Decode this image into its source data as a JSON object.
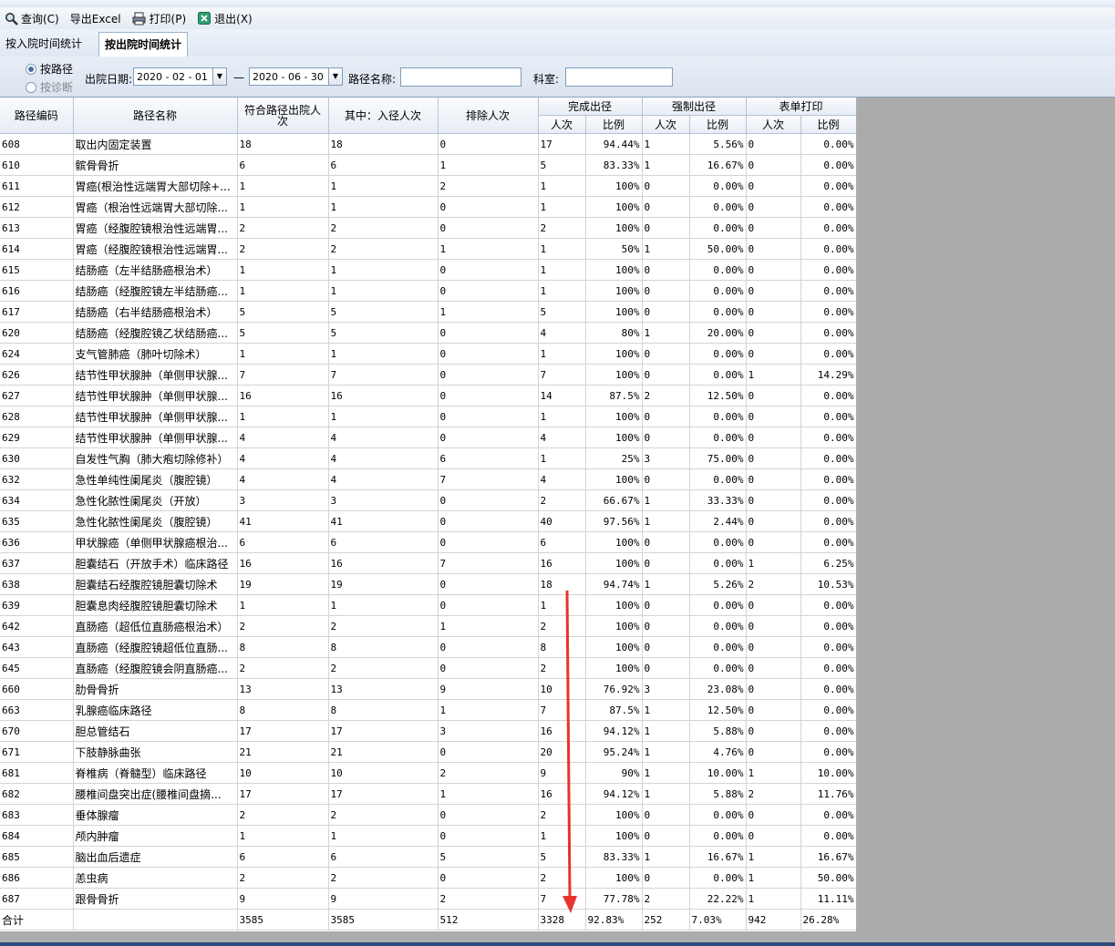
{
  "toolbar": {
    "query_label": "查询(C)",
    "export_label": "导出Excel",
    "print_label": "打印(P)",
    "exit_label": "退出(X)"
  },
  "tabs": [
    {
      "label": "按入院时间统计",
      "active": false
    },
    {
      "label": "按出院时间统计",
      "active": true
    }
  ],
  "filter": {
    "radio_path": "按路径",
    "radio_diag": "按诊断",
    "date_label": "出院日期:",
    "date_from": "2020 - 02 - 01",
    "date_sep": "—",
    "date_to": "2020 - 06 - 30",
    "path_name_label": "路径名称:",
    "path_name_value": "",
    "dept_label": "科室:",
    "dept_value": ""
  },
  "table": {
    "headers": {
      "code": "路径编码",
      "name": "路径名称",
      "eligible": "符合路径出院人次",
      "entered": "其中：入径人次",
      "excluded": "排除人次",
      "complete": "完成出径",
      "forced": "强制出径",
      "form_print": "表单打印",
      "count": "人次",
      "ratio": "比例"
    },
    "rows": [
      [
        "608",
        "取出内固定装置",
        "18",
        "18",
        "0",
        "17",
        "94.44%",
        "1",
        "5.56%",
        "0",
        "0.00%"
      ],
      [
        "610",
        "髌骨骨折",
        "6",
        "6",
        "1",
        "5",
        "83.33%",
        "1",
        "16.67%",
        "0",
        "0.00%"
      ],
      [
        "611",
        "胃癌(根治性远端胃大部切除+...",
        "1",
        "1",
        "2",
        "1",
        "100%",
        "0",
        "0.00%",
        "0",
        "0.00%"
      ],
      [
        "612",
        "胃癌（根治性远端胃大部切除...",
        "1",
        "1",
        "0",
        "1",
        "100%",
        "0",
        "0.00%",
        "0",
        "0.00%"
      ],
      [
        "613",
        "胃癌（经腹腔镜根治性远端胃...",
        "2",
        "2",
        "0",
        "2",
        "100%",
        "0",
        "0.00%",
        "0",
        "0.00%"
      ],
      [
        "614",
        "胃癌（经腹腔镜根治性远端胃...",
        "2",
        "2",
        "1",
        "1",
        "50%",
        "1",
        "50.00%",
        "0",
        "0.00%"
      ],
      [
        "615",
        "结肠癌（左半结肠癌根治术）",
        "1",
        "1",
        "0",
        "1",
        "100%",
        "0",
        "0.00%",
        "0",
        "0.00%"
      ],
      [
        "616",
        "结肠癌（经腹腔镜左半结肠癌...",
        "1",
        "1",
        "0",
        "1",
        "100%",
        "0",
        "0.00%",
        "0",
        "0.00%"
      ],
      [
        "617",
        "结肠癌（右半结肠癌根治术）",
        "5",
        "5",
        "1",
        "5",
        "100%",
        "0",
        "0.00%",
        "0",
        "0.00%"
      ],
      [
        "620",
        "结肠癌（经腹腔镜乙状结肠癌...",
        "5",
        "5",
        "0",
        "4",
        "80%",
        "1",
        "20.00%",
        "0",
        "0.00%"
      ],
      [
        "624",
        "支气管肺癌（肺叶切除术）",
        "1",
        "1",
        "0",
        "1",
        "100%",
        "0",
        "0.00%",
        "0",
        "0.00%"
      ],
      [
        "626",
        "结节性甲状腺肿（单侧甲状腺...",
        "7",
        "7",
        "0",
        "7",
        "100%",
        "0",
        "0.00%",
        "1",
        "14.29%"
      ],
      [
        "627",
        "结节性甲状腺肿（单侧甲状腺...",
        "16",
        "16",
        "0",
        "14",
        "87.5%",
        "2",
        "12.50%",
        "0",
        "0.00%"
      ],
      [
        "628",
        "结节性甲状腺肿（单侧甲状腺...",
        "1",
        "1",
        "0",
        "1",
        "100%",
        "0",
        "0.00%",
        "0",
        "0.00%"
      ],
      [
        "629",
        "结节性甲状腺肿（单侧甲状腺...",
        "4",
        "4",
        "0",
        "4",
        "100%",
        "0",
        "0.00%",
        "0",
        "0.00%"
      ],
      [
        "630",
        "自发性气胸（肺大疱切除修补）",
        "4",
        "4",
        "6",
        "1",
        "25%",
        "3",
        "75.00%",
        "0",
        "0.00%"
      ],
      [
        "632",
        "急性单纯性阑尾炎（腹腔镜）",
        "4",
        "4",
        "7",
        "4",
        "100%",
        "0",
        "0.00%",
        "0",
        "0.00%"
      ],
      [
        "634",
        "急性化脓性阑尾炎（开放）",
        "3",
        "3",
        "0",
        "2",
        "66.67%",
        "1",
        "33.33%",
        "0",
        "0.00%"
      ],
      [
        "635",
        "急性化脓性阑尾炎（腹腔镜）",
        "41",
        "41",
        "0",
        "40",
        "97.56%",
        "1",
        "2.44%",
        "0",
        "0.00%"
      ],
      [
        "636",
        "甲状腺癌（单侧甲状腺癌根治...",
        "6",
        "6",
        "0",
        "6",
        "100%",
        "0",
        "0.00%",
        "0",
        "0.00%"
      ],
      [
        "637",
        "胆囊结石（开放手术）临床路径",
        "16",
        "16",
        "7",
        "16",
        "100%",
        "0",
        "0.00%",
        "1",
        "6.25%"
      ],
      [
        "638",
        "胆囊结石经腹腔镜胆囊切除术",
        "19",
        "19",
        "0",
        "18",
        "94.74%",
        "1",
        "5.26%",
        "2",
        "10.53%"
      ],
      [
        "639",
        "胆囊息肉经腹腔镜胆囊切除术",
        "1",
        "1",
        "0",
        "1",
        "100%",
        "0",
        "0.00%",
        "0",
        "0.00%"
      ],
      [
        "642",
        "直肠癌（超低位直肠癌根治术）",
        "2",
        "2",
        "1",
        "2",
        "100%",
        "0",
        "0.00%",
        "0",
        "0.00%"
      ],
      [
        "643",
        "直肠癌（经腹腔镜超低位直肠...",
        "8",
        "8",
        "0",
        "8",
        "100%",
        "0",
        "0.00%",
        "0",
        "0.00%"
      ],
      [
        "645",
        "直肠癌（经腹腔镜会阴直肠癌...",
        "2",
        "2",
        "0",
        "2",
        "100%",
        "0",
        "0.00%",
        "0",
        "0.00%"
      ],
      [
        "660",
        "肋骨骨折",
        "13",
        "13",
        "9",
        "10",
        "76.92%",
        "3",
        "23.08%",
        "0",
        "0.00%"
      ],
      [
        "663",
        "乳腺癌临床路径",
        "8",
        "8",
        "1",
        "7",
        "87.5%",
        "1",
        "12.50%",
        "0",
        "0.00%"
      ],
      [
        "670",
        "胆总管结石",
        "17",
        "17",
        "3",
        "16",
        "94.12%",
        "1",
        "5.88%",
        "0",
        "0.00%"
      ],
      [
        "671",
        "下肢静脉曲张",
        "21",
        "21",
        "0",
        "20",
        "95.24%",
        "1",
        "4.76%",
        "0",
        "0.00%"
      ],
      [
        "681",
        "脊椎病（脊髓型）临床路径",
        "10",
        "10",
        "2",
        "9",
        "90%",
        "1",
        "10.00%",
        "1",
        "10.00%"
      ],
      [
        "682",
        "腰椎间盘突出症(腰椎间盘摘...",
        "17",
        "17",
        "1",
        "16",
        "94.12%",
        "1",
        "5.88%",
        "2",
        "11.76%"
      ],
      [
        "683",
        "垂体腺瘤",
        "2",
        "2",
        "0",
        "2",
        "100%",
        "0",
        "0.00%",
        "0",
        "0.00%"
      ],
      [
        "684",
        "颅内肿瘤",
        "1",
        "1",
        "0",
        "1",
        "100%",
        "0",
        "0.00%",
        "0",
        "0.00%"
      ],
      [
        "685",
        "脑出血后遗症",
        "6",
        "6",
        "5",
        "5",
        "83.33%",
        "1",
        "16.67%",
        "1",
        "16.67%"
      ],
      [
        "686",
        "恙虫病",
        "2",
        "2",
        "0",
        "2",
        "100%",
        "0",
        "0.00%",
        "1",
        "50.00%"
      ],
      [
        "687",
        "跟骨骨折",
        "9",
        "9",
        "2",
        "7",
        "77.78%",
        "2",
        "22.22%",
        "1",
        "11.11%"
      ]
    ],
    "total": [
      "合计",
      "",
      "3585",
      "3585",
      "512",
      "3328",
      "92.83%",
      "252",
      "7.03%",
      "942",
      "26.28%"
    ]
  },
  "colors": {
    "highlight": "#fbc86d",
    "arrow": "#e8342c"
  }
}
